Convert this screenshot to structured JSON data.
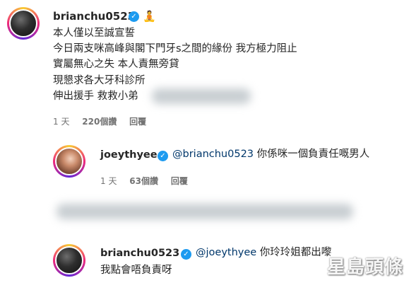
{
  "comment1": {
    "username": "brianchu0523",
    "verified_icon": "verified-check-icon",
    "emoji_icon": "meditating-person-emoji",
    "lines": [
      "本人僅以至誠宣誓",
      "今日兩支咪高峰與閣下門牙s之間的緣份 我方極力阻止",
      "實屬無心之失 本人責無旁貸",
      "現懇求各大牙科診所",
      "伸出援手 救救小弟"
    ],
    "time": "1 天",
    "likes": "220個讚",
    "reply": "回覆"
  },
  "reply1": {
    "username": "joeythyee",
    "verified_icon": "verified-check-icon",
    "mention": "@brianchu0523",
    "text": " 你係咪一個負責任嘅男人",
    "time": "1 天",
    "likes": "63個讚",
    "reply": "回覆"
  },
  "reply2": {
    "username": "brianchu0523",
    "verified_icon": "verified-check-icon",
    "mention": "@joeythyee",
    "text": " 你玲玲姐都出嚟",
    "line2": "我點會唔負責呀"
  },
  "watermark": "星島頭條",
  "colors": {
    "verified": "#1d9bf0",
    "mention": "#00376b",
    "meta": "#737373"
  }
}
